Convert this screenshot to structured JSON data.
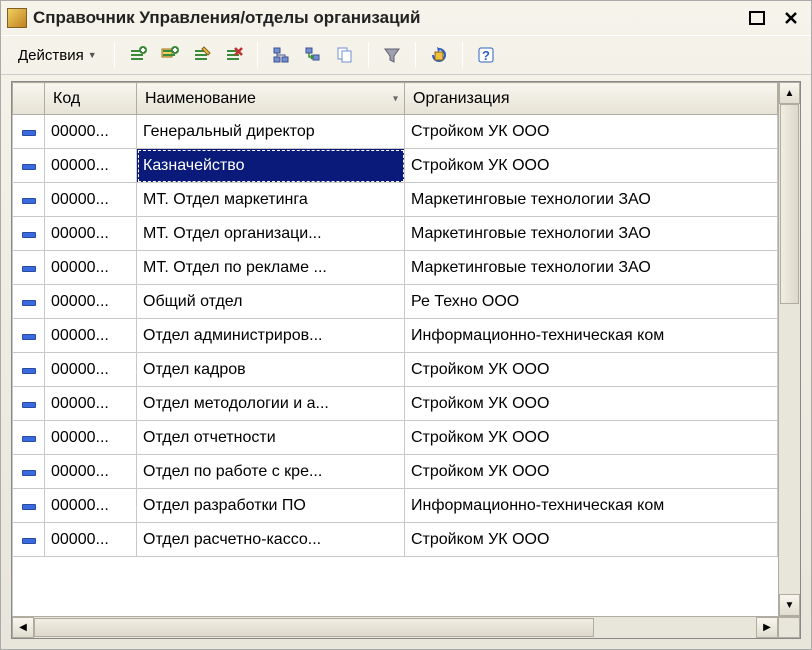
{
  "window": {
    "title": "Справочник Управления/отделы организаций"
  },
  "toolbar": {
    "actions_label": "Действия"
  },
  "columns": {
    "icon": "",
    "code": "Код",
    "name": "Наименование",
    "org": "Организация"
  },
  "selected_row_index": 1,
  "rows": [
    {
      "code": "00000...",
      "name": "Генеральный директор",
      "org": "Стройком УК ООО"
    },
    {
      "code": "00000...",
      "name": "Казначейство",
      "org": "Стройком УК ООО"
    },
    {
      "code": "00000...",
      "name": "МТ. Отдел маркетинга",
      "org": "Маркетинговые технологии ЗАО"
    },
    {
      "code": "00000...",
      "name": "МТ. Отдел организаци...",
      "org": "Маркетинговые технологии ЗАО"
    },
    {
      "code": "00000...",
      "name": "МТ. Отдел по рекламе ...",
      "org": "Маркетинговые технологии ЗАО"
    },
    {
      "code": "00000...",
      "name": "Общий отдел",
      "org": "Ре Техно ООО"
    },
    {
      "code": "00000...",
      "name": "Отдел администриров...",
      "org": "Информационно-техническая ком"
    },
    {
      "code": "00000...",
      "name": "Отдел кадров",
      "org": "Стройком УК ООО"
    },
    {
      "code": "00000...",
      "name": "Отдел методологии и а...",
      "org": "Стройком УК ООО"
    },
    {
      "code": "00000...",
      "name": "Отдел отчетности",
      "org": "Стройком УК ООО"
    },
    {
      "code": "00000...",
      "name": "Отдел по работе с кре...",
      "org": "Стройком УК ООО"
    },
    {
      "code": "00000...",
      "name": "Отдел разработки ПО",
      "org": "Информационно-техническая ком"
    },
    {
      "code": "00000...",
      "name": "Отдел расчетно-кассо...",
      "org": "Стройком УК ООО"
    }
  ]
}
